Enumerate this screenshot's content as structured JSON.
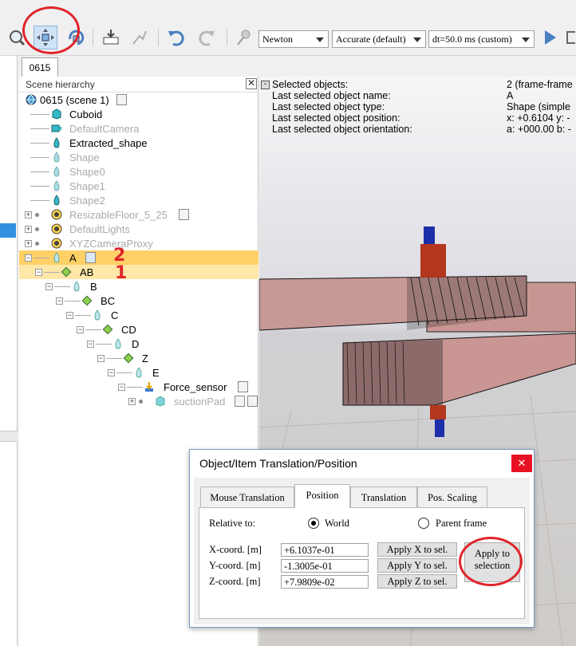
{
  "toolbar": {
    "engine_select": "Newton",
    "accuracy_select": "Accurate (default)",
    "dt_select": "dt=50.0 ms (custom)"
  },
  "document_tab": "0615",
  "hierarchy": {
    "title": "Scene hierarchy",
    "close_label": "✕",
    "items": [
      {
        "label": "0615 (scene 1)"
      },
      {
        "label": "Cuboid"
      },
      {
        "label": "DefaultCamera"
      },
      {
        "label": "Extracted_shape"
      },
      {
        "label": "Shape"
      },
      {
        "label": "Shape0"
      },
      {
        "label": "Shape1"
      },
      {
        "label": "Shape2"
      },
      {
        "label": "ResizableFloor_5_25"
      },
      {
        "label": "DefaultLights"
      },
      {
        "label": "XYZCameraProxy"
      },
      {
        "label": "A"
      },
      {
        "label": "AB"
      },
      {
        "label": "B"
      },
      {
        "label": "BC"
      },
      {
        "label": "C"
      },
      {
        "label": "CD"
      },
      {
        "label": "D"
      },
      {
        "label": "Z"
      },
      {
        "label": "E"
      },
      {
        "label": "Force_sensor"
      },
      {
        "label": "suctionPad"
      }
    ],
    "annotations": {
      "num_a": "2",
      "num_ab": "1"
    }
  },
  "viewport_info": {
    "labels": [
      "Selected objects:",
      "Last selected object name:",
      "Last selected object type:",
      "Last selected object position:",
      "Last selected object orientation:"
    ],
    "values": [
      "2 (frame-frame",
      "A",
      "Shape (simple",
      "x: +0.6104   y: -",
      "a: +000.00    b: -"
    ]
  },
  "dialog": {
    "title": "Object/Item Translation/Position",
    "close_label": "✕",
    "tabs": [
      "Mouse Translation",
      "Position",
      "Translation",
      "Pos. Scaling"
    ],
    "relative_to_label": "Relative to:",
    "world_label": "World",
    "parent_frame_label": "Parent frame",
    "x_label": "X-coord. [m]",
    "y_label": "Y-coord. [m]",
    "z_label": "Z-coord. [m]",
    "x_value": "+6.1037e-01",
    "y_value": "-1.3005e-01",
    "z_value": "+7.9809e-02",
    "apply_x": "Apply X to sel.",
    "apply_y": "Apply Y to sel.",
    "apply_z": "Apply Z to sel.",
    "apply_all": "Apply to selection"
  }
}
